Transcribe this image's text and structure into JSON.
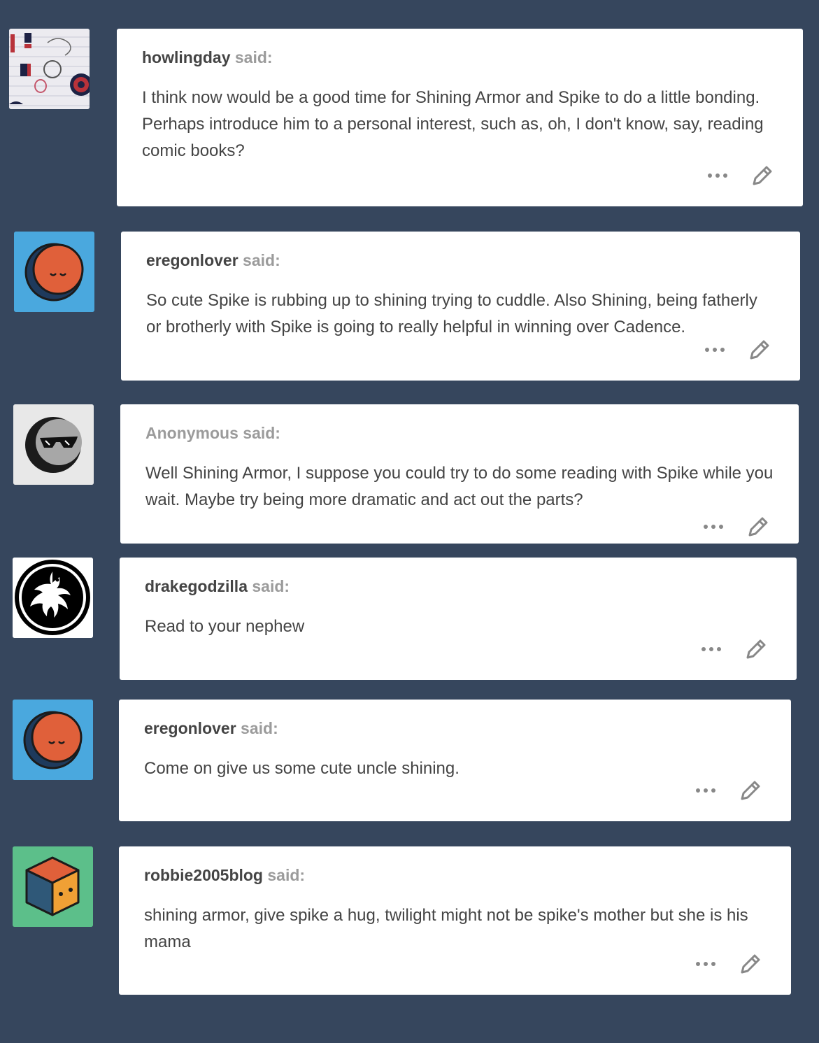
{
  "said_label": "said:",
  "posts": [
    {
      "username": "howlingday",
      "text": "I think now would be a good time for Shining Armor and Spike to do a little bonding. Perhaps introduce him to a personal interest, such as, oh, I don't know, say, reading comic books?",
      "avatar": "sketch-avatar"
    },
    {
      "username": "eregonlover",
      "text": "So cute Spike is rubbing up to shining trying to cuddle. Also Shining, being fatherly or brotherly with Spike is going to really helpful in winning over Cadence.",
      "avatar": "sleepy-moon-avatar"
    },
    {
      "username": "Anonymous",
      "text": "Well Shining Armor, I suppose you could try to do some reading with Spike while you wait. Maybe try being more dramatic and act out the parts?",
      "avatar": "sunglasses-moon-avatar"
    },
    {
      "username": "drakegodzilla",
      "text": "Read to your nephew",
      "avatar": "dragon-logo-avatar"
    },
    {
      "username": "eregonlover",
      "text": "Come on give us some cute uncle shining.",
      "avatar": "sleepy-moon-avatar"
    },
    {
      "username": "robbie2005blog",
      "text": "shining armor, give spike a hug, twilight might not be spike's mother but she is his mama",
      "avatar": "cube-avatar"
    }
  ],
  "colors": {
    "background": "#36465d",
    "card": "#ffffff",
    "text": "#444444",
    "muted": "#9b9b9b",
    "avatar_blue": "#4aa8de",
    "avatar_green": "#5cbf8a",
    "moon_orange": "#e0603a"
  },
  "icons": {
    "more": "more-dots-icon",
    "edit": "pencil-icon"
  }
}
